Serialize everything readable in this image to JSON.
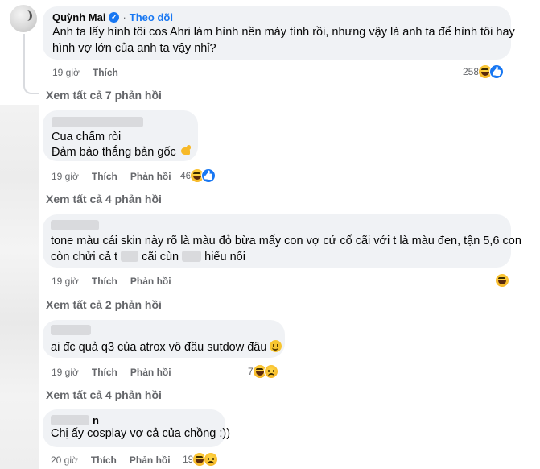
{
  "main_comment": {
    "author": "Quỳnh Mai",
    "follow_label": "Theo dõi",
    "separator": "·",
    "lines": [
      "Anh ta lấy hình tôi cos Ahri làm hình nền máy tính rồi, nhưng vậy là anh ta để hình tôi hay",
      "hình vợ lớn của anh ta vậy nhỉ?"
    ],
    "time": "19 giờ",
    "like_label": "Thích",
    "reaction_count": "258",
    "view_replies": "Xem tất cả 7 phản hồi"
  },
  "replies": [
    {
      "lines": [
        "Cua chấm ròi",
        "Đảm bảo thắng bản gốc"
      ],
      "time": "19 giờ",
      "like_label": "Thích",
      "reply_label": "Phản hồi",
      "reaction_count": "46",
      "view_replies": "Xem tất cả 4 phản hồi"
    },
    {
      "line1": "tone màu cái skin này rõ là màu đỏ bừa mấy con vợ cứ cố cãi với t là màu đen, tận 5,6 con",
      "line2_a": "còn chửi cả t",
      "line2_b": "cãi cùn",
      "line2_c": "hiểu nổi",
      "time": "19 giờ",
      "like_label": "Thích",
      "reply_label": "Phản hồi",
      "view_replies": "Xem tất cả 2 phản hồi"
    },
    {
      "line1": "ai đc quả q3 của atrox vô đầu sutdow đâu",
      "time": "19 giờ",
      "like_label": "Thích",
      "reply_label": "Phản hồi",
      "reaction_count": "7",
      "view_replies": "Xem tất cả 4 phản hồi"
    },
    {
      "name_partial": "n",
      "line1": "Chị ấy cosplay vợ cả của chồng :))",
      "time": "20 giờ",
      "like_label": "Thích",
      "reply_label": "Phản hồi",
      "reaction_count": "19"
    }
  ]
}
